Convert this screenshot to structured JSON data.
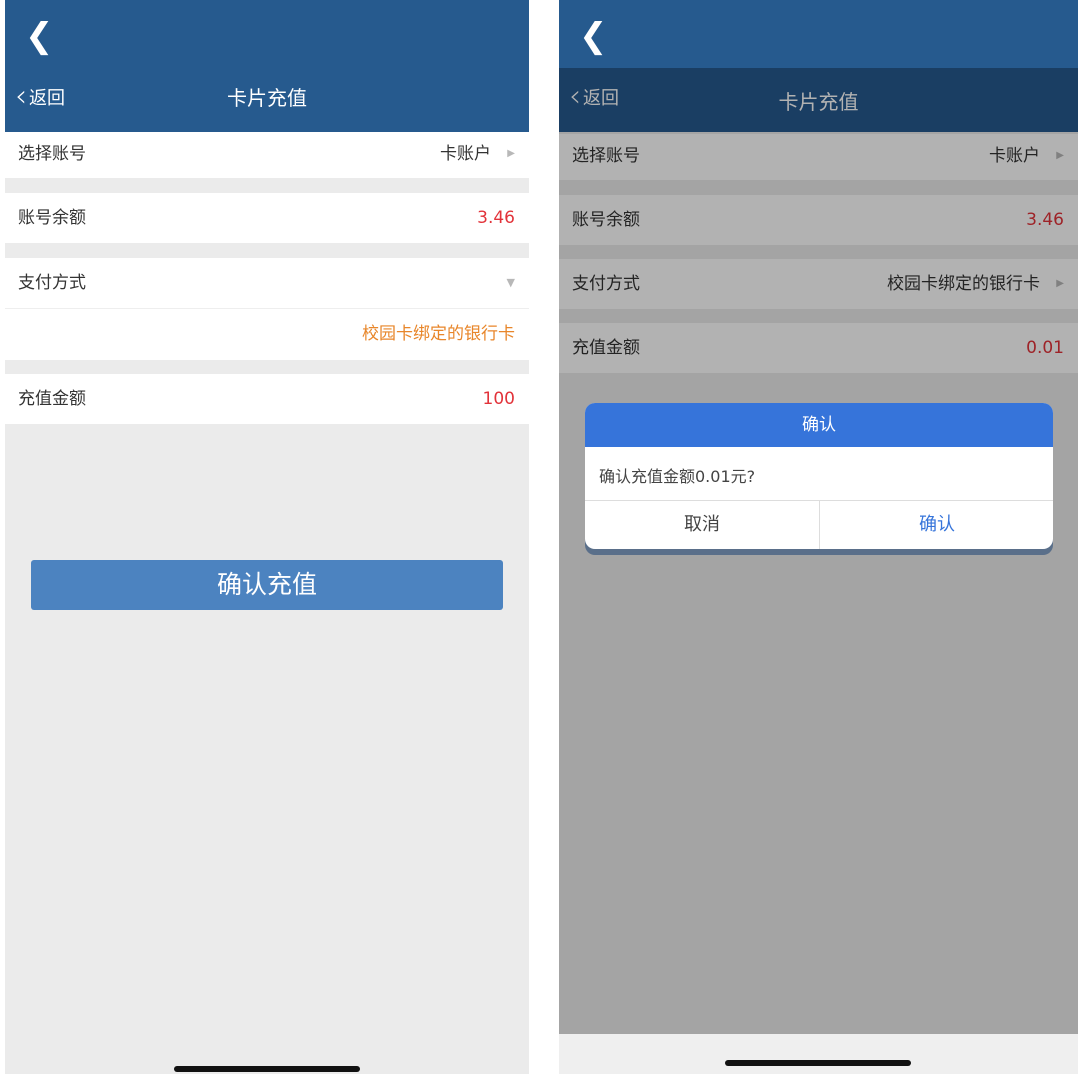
{
  "left": {
    "nav": {
      "back_label": "返回",
      "title": "卡片充值"
    },
    "rows": {
      "account": {
        "label": "选择账号",
        "value": "卡账户"
      },
      "balance": {
        "label": "账号余额",
        "value": "3.46"
      },
      "payment": {
        "label": "支付方式",
        "selected": "校园卡绑定的银行卡"
      },
      "amount": {
        "label": "充值金额",
        "value": "100"
      }
    },
    "confirm_button": "确认充值"
  },
  "right": {
    "nav": {
      "back_label": "返回",
      "title": "卡片充值"
    },
    "rows": {
      "account": {
        "label": "选择账号",
        "value": "卡账户"
      },
      "balance": {
        "label": "账号余额",
        "value": "3.46"
      },
      "payment": {
        "label": "支付方式",
        "value": "校园卡绑定的银行卡"
      },
      "amount": {
        "label": "充值金额",
        "value": "0.01"
      }
    },
    "dialog": {
      "title": "确认",
      "message": "确认充值金额0.01元?",
      "cancel": "取消",
      "ok": "确认"
    }
  },
  "colors": {
    "header": "#265a8e",
    "button": "#4c83c0",
    "dialog_header": "#3674da",
    "amount_red": "#e2333a",
    "payment_orange": "#e8862a"
  },
  "icons": [
    "back-chevron-icon",
    "right-arrow-icon",
    "dropdown-arrow-icon"
  ]
}
